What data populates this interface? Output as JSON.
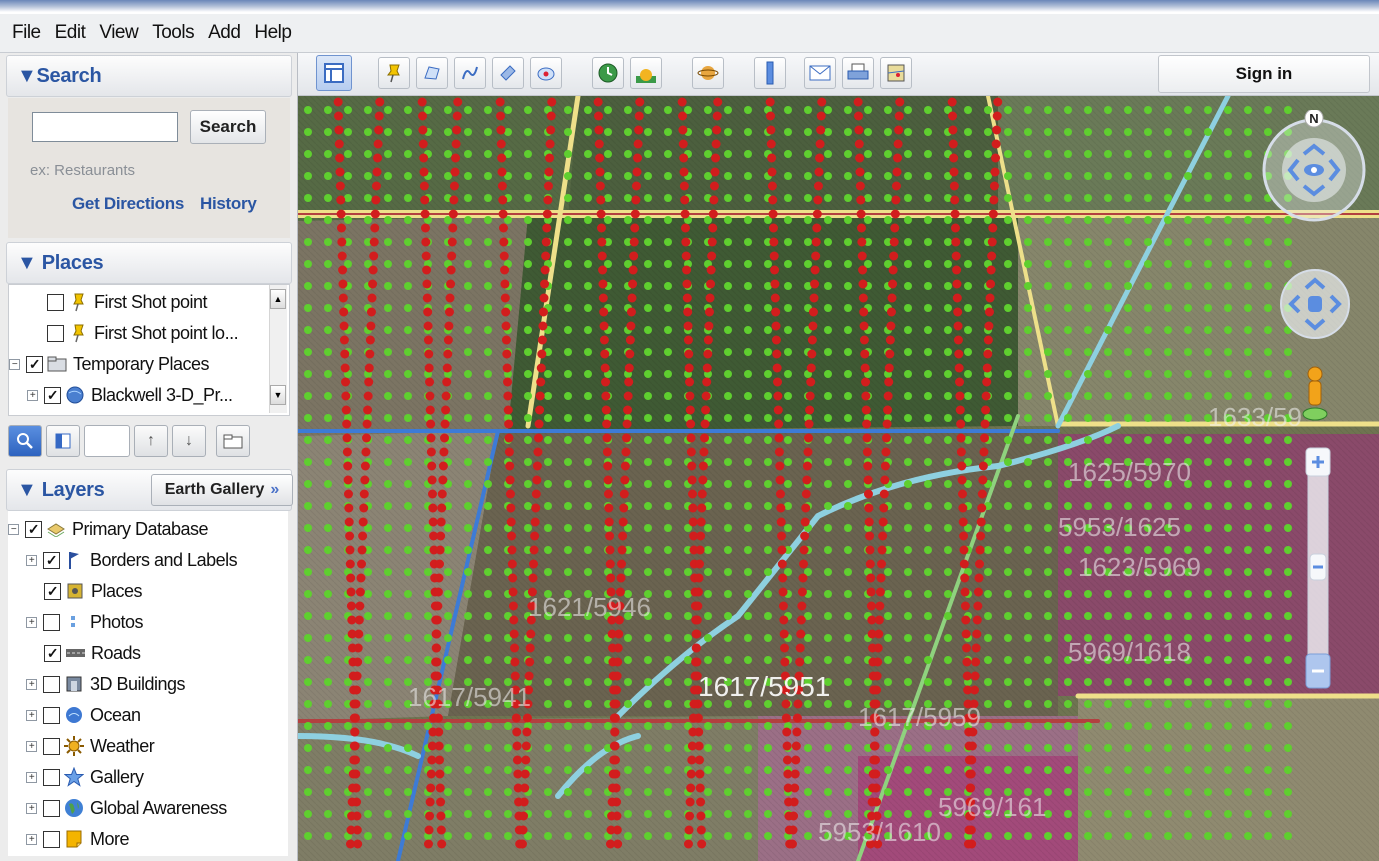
{
  "menu": {
    "items": [
      "File",
      "Edit",
      "View",
      "Tools",
      "Add",
      "Help"
    ]
  },
  "search": {
    "header": "▼Search",
    "input_value": "",
    "button": "Search",
    "hint": "ex: Restaurants",
    "get_directions": "Get Directions",
    "history": "History"
  },
  "places": {
    "header": "▼ Places",
    "items": [
      {
        "label": "First Shot point",
        "checked": false
      },
      {
        "label": "First Shot point lo...",
        "checked": false
      },
      {
        "label": "Temporary Places",
        "checked": true
      },
      {
        "label": "Blackwell 3-D_Pr...",
        "checked": true
      }
    ]
  },
  "layers": {
    "header": "▼ Layers",
    "gallery_button": "Earth Gallery",
    "gallery_arrow": "»",
    "items": [
      {
        "label": "Primary Database",
        "checked": true,
        "icon": "database-icon"
      },
      {
        "label": "Borders and Labels",
        "checked": true,
        "icon": "flag-icon"
      },
      {
        "label": "Places",
        "checked": true,
        "icon": "places-icon"
      },
      {
        "label": "Photos",
        "checked": false,
        "icon": "photo-icon"
      },
      {
        "label": "Roads",
        "checked": true,
        "icon": "roads-icon"
      },
      {
        "label": "3D Buildings",
        "checked": false,
        "icon": "building-icon"
      },
      {
        "label": "Ocean",
        "checked": false,
        "icon": "ocean-icon"
      },
      {
        "label": "Weather",
        "checked": false,
        "icon": "sun-icon"
      },
      {
        "label": "Gallery",
        "checked": false,
        "icon": "star-icon"
      },
      {
        "label": "Global Awareness",
        "checked": false,
        "icon": "globe-icon"
      },
      {
        "label": "More",
        "checked": false,
        "icon": "note-icon"
      }
    ]
  },
  "toolbar": {
    "sign_in": "Sign in"
  },
  "navigation": {
    "north": "N"
  },
  "map": {
    "labels": [
      "1617/5951",
      "1617/5959",
      "5969/161",
      "5953/1610",
      "5969/1618",
      "1623/5969",
      "1625/5970",
      "5953/1625",
      "1633/59",
      "1621/5946",
      "1617/5941"
    ]
  }
}
